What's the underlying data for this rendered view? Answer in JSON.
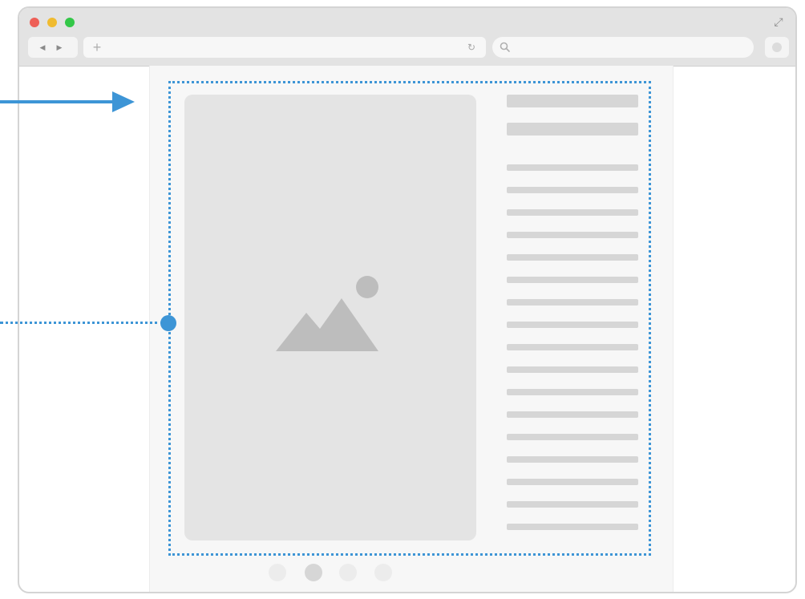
{
  "window": {
    "traffic_lights": {
      "close_color": "#ee5f57",
      "minimize_color": "#f0bb30",
      "maximize_color": "#33c748"
    },
    "nav": {
      "back_icon": "back-arrow-icon",
      "forward_icon": "forward-arrow-icon"
    },
    "address_bar": {
      "new_tab_icon": "plus-icon",
      "reload_icon": "reload-icon",
      "value": ""
    },
    "search": {
      "icon": "search-icon",
      "value": ""
    },
    "settings_icon": "settings-icon"
  },
  "page": {
    "image_placeholder": {
      "icon": "image-placeholder-icon"
    },
    "heading_lines": 2,
    "body_lines": 17,
    "pagination": {
      "count": 4,
      "active_index": 1
    }
  },
  "annotation": {
    "color": "#3d95d6"
  }
}
